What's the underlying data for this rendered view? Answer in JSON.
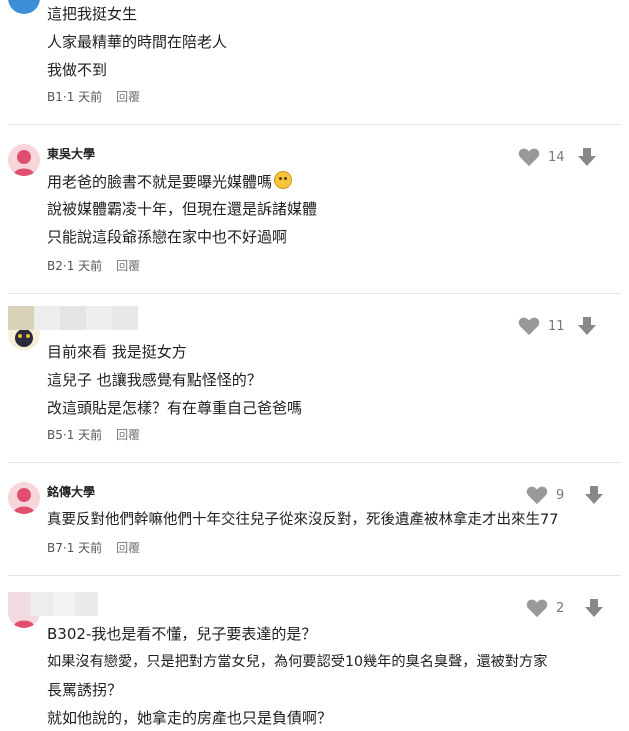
{
  "comments": [
    {
      "author": "",
      "lines": [
        "這把我挺女生",
        "人家最精華的時間在陪老人",
        "我做不到"
      ],
      "floor": "B1",
      "time": "1 天前",
      "reply": "回覆",
      "likes": ""
    },
    {
      "author": "東吳大學",
      "lines": [
        "用老爸的臉書不就是要曝光媒體嗎",
        "說被媒體霸凌十年，但現在還是訴諸媒體",
        "只能說這段爺孫戀在家中也不好過啊"
      ],
      "floor": "B2",
      "time": "1 天前",
      "reply": "回覆",
      "likes": "14"
    },
    {
      "author": "",
      "lines": [
        "目前來看 我是挺女方",
        "這兒子 也讓我感覺有點怪怪的？",
        "改這頭貼是怎樣？有在尊重自己爸爸嗎"
      ],
      "floor": "B5",
      "time": "1 天前",
      "reply": "回覆",
      "likes": "11"
    },
    {
      "author": "銘傳大學",
      "lines": [
        "真要反對他們幹嘛他們十年交往兒子從來沒反對，死後遺產被林拿走才出來生77"
      ],
      "floor": "B7",
      "time": "1 天前",
      "reply": "回覆",
      "likes": "9"
    },
    {
      "author": "",
      "lines": [
        "B302-我也是看不懂，兒子要表達的是？",
        "如果沒有戀愛，只是把對方當女兒，為何要認受10幾年的臭名臭聲，還被對方家",
        "長罵誘拐？",
        "就如他說的，她拿走的房產也只是負債啊？"
      ],
      "floor": "",
      "time": "",
      "reply": "",
      "likes": "2"
    }
  ],
  "meta_separator": "·",
  "icons": {
    "like": "heart-icon",
    "dislike": "down-arrow-icon"
  },
  "colors": {
    "avatar_pink": "#f7d6db",
    "avatar_accent": "#e0506e",
    "icon_gray": "#999999",
    "divider": "#e6e6e6"
  }
}
